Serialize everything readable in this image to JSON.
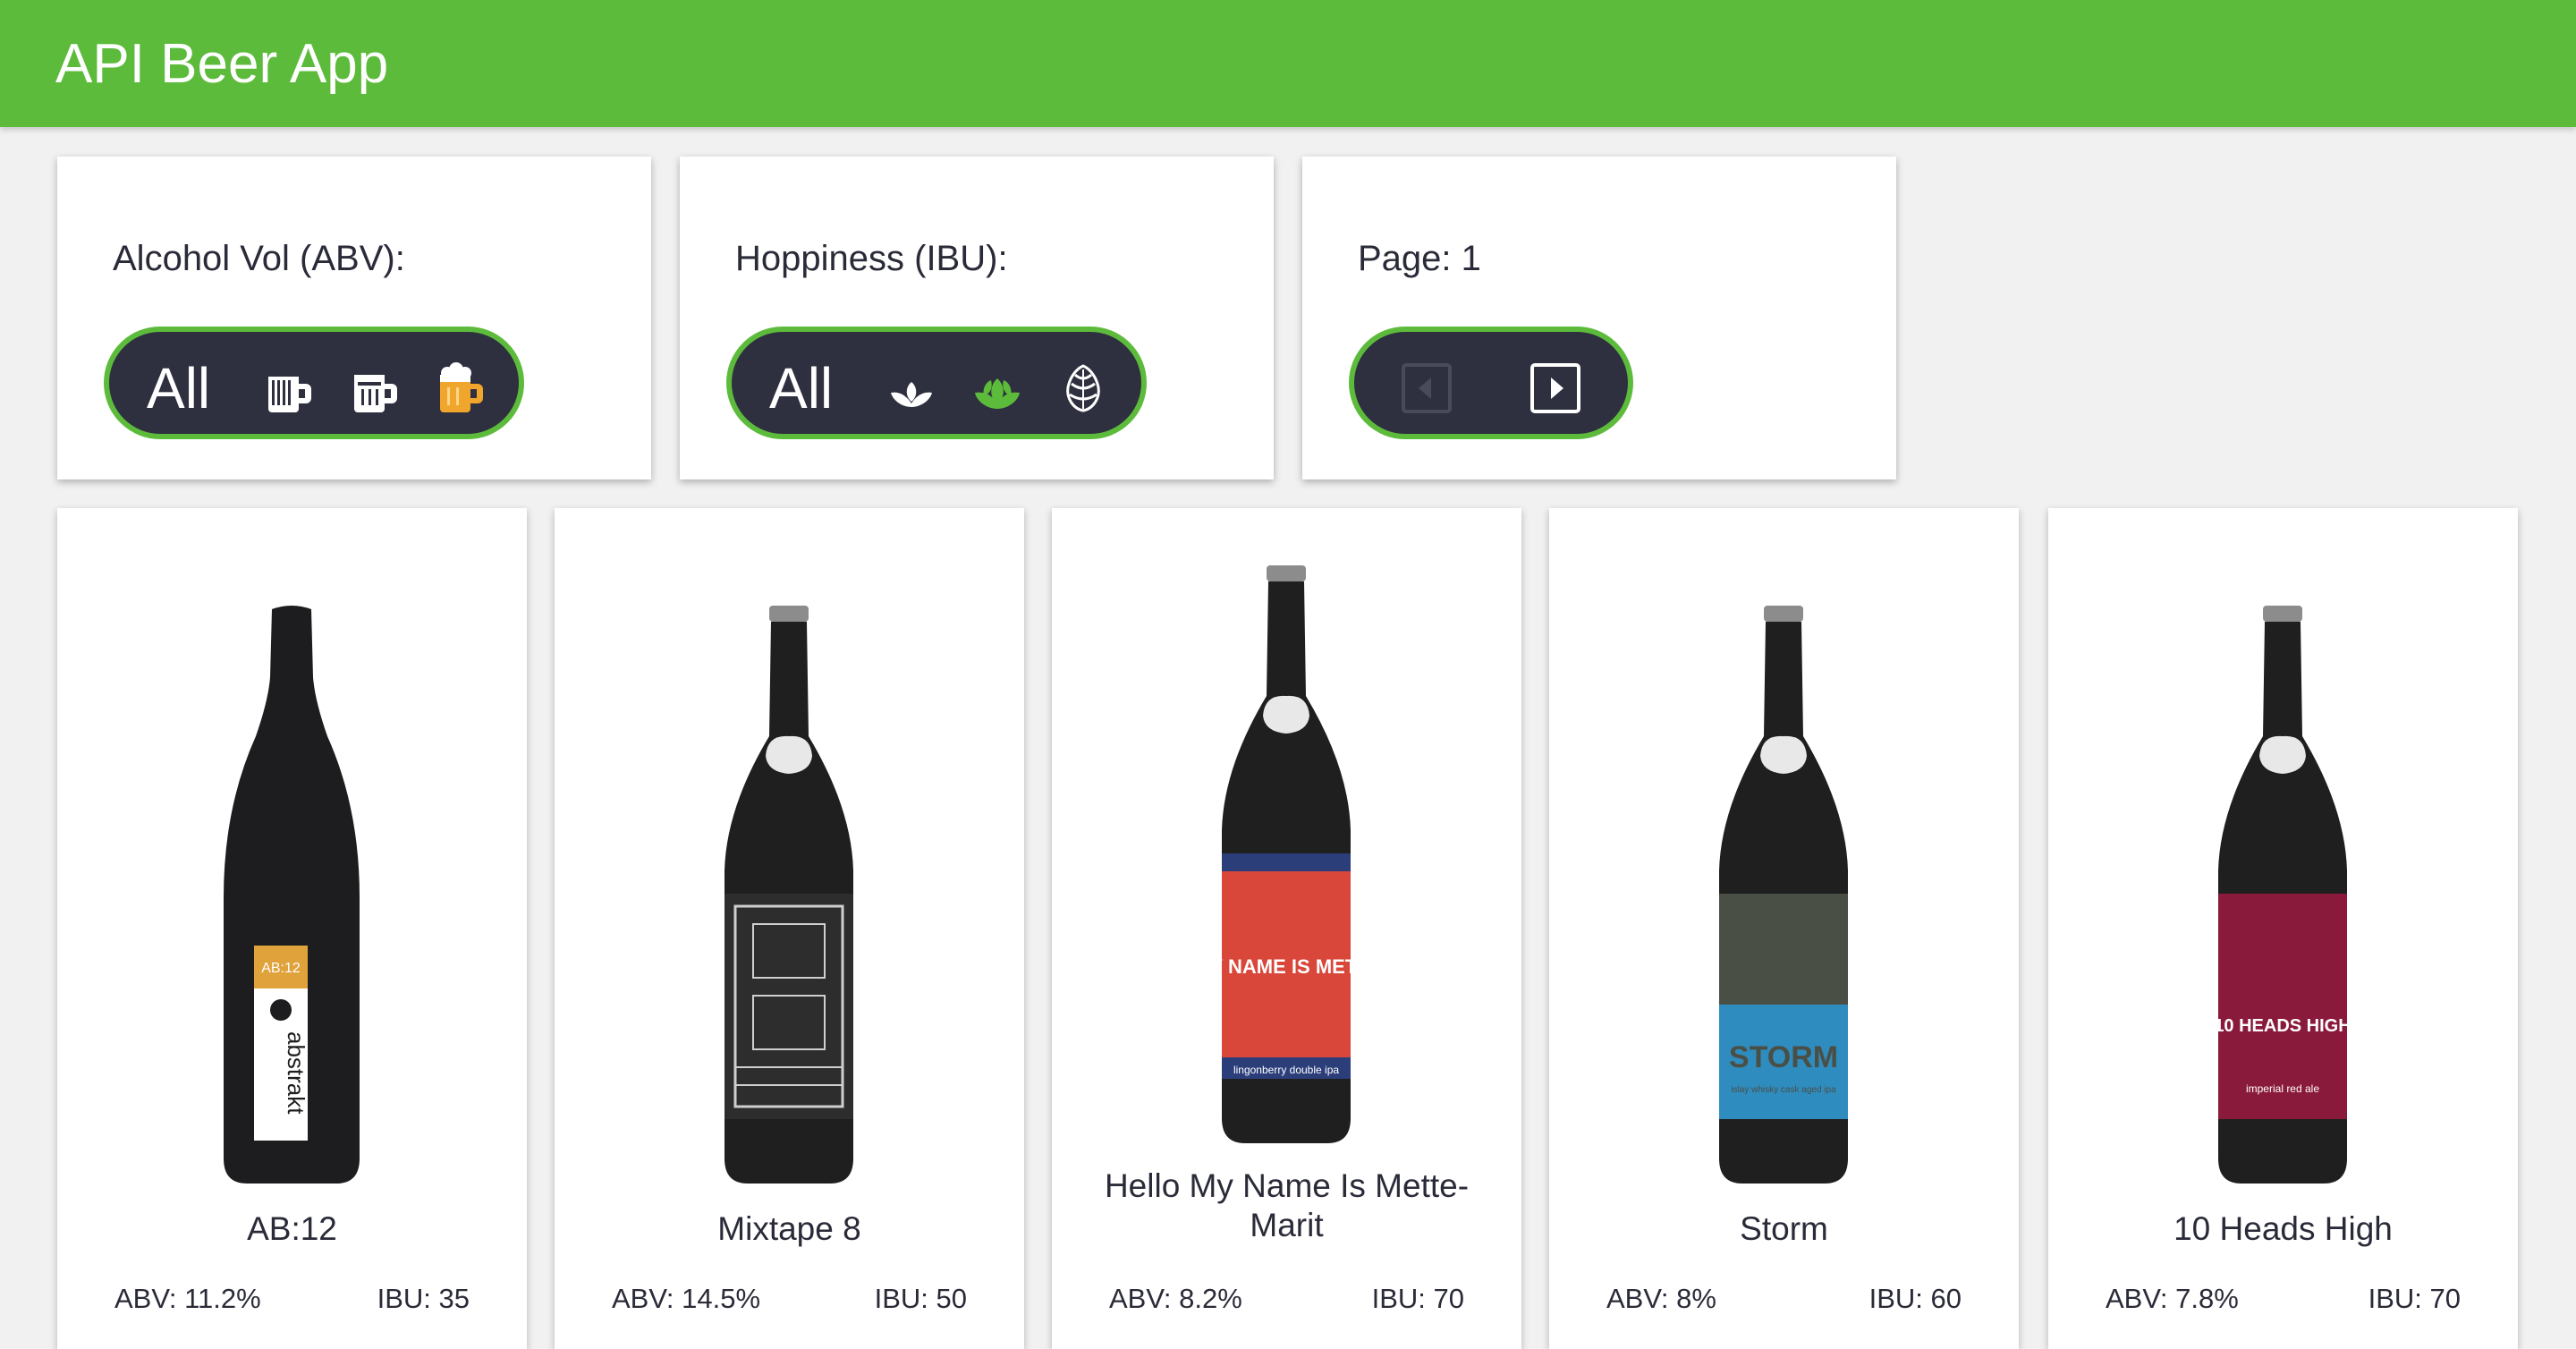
{
  "app": {
    "title": "API Beer App"
  },
  "filters": {
    "abv": {
      "label": "Alcohol Vol (ABV):",
      "all_label": "All",
      "options": [
        "low-abv-mug-icon",
        "medium-abv-mug-icon",
        "high-abv-mug-icon"
      ],
      "selected": "high-abv-mug-icon"
    },
    "ibu": {
      "label": "Hoppiness (IBU):",
      "all_label": "All",
      "options": [
        "low-ibu-hop-icon",
        "medium-ibu-hop-icon",
        "high-ibu-hop-icon"
      ],
      "selected": "medium-ibu-hop-icon"
    },
    "page": {
      "label": "Page: 1",
      "prev_icon": "prev-page-icon",
      "next_icon": "next-page-icon"
    }
  },
  "colors": {
    "brand": "#5dbb3c",
    "pill": "#2e2f3f",
    "selected_abv": "#f0a52c",
    "selected_ibu": "#5dbb3c"
  },
  "beers": [
    {
      "name": "AB:12",
      "abv": "ABV: 11.2%",
      "ibu": "IBU: 35",
      "bottle": "ab12-bottle-image",
      "label_text": "AB:12",
      "label_sub": "abstrakt"
    },
    {
      "name": "Mixtape 8",
      "abv": "ABV: 14.5%",
      "ibu": "IBU: 50",
      "bottle": "mixtape8-bottle-image"
    },
    {
      "name": "Hello My Name Is Mette-Marit",
      "abv": "ABV: 8.2%",
      "ibu": "IBU: 70",
      "bottle": "hello-my-name-is-bottle-image",
      "label_text": "HELLO MY NAME IS METTE-MARIT",
      "label_sub": "lingonberry double ipa"
    },
    {
      "name": "Storm",
      "abv": "ABV: 8%",
      "ibu": "IBU: 60",
      "bottle": "storm-bottle-image",
      "label_text": "STORM",
      "label_sub": "islay whisky cask aged ipa"
    },
    {
      "name": "10 Heads High",
      "abv": "ABV: 7.8%",
      "ibu": "IBU: 70",
      "bottle": "10-heads-high-bottle-image",
      "label_text": "10 HEADS HIGH",
      "label_sub": "imperial red ale"
    }
  ]
}
